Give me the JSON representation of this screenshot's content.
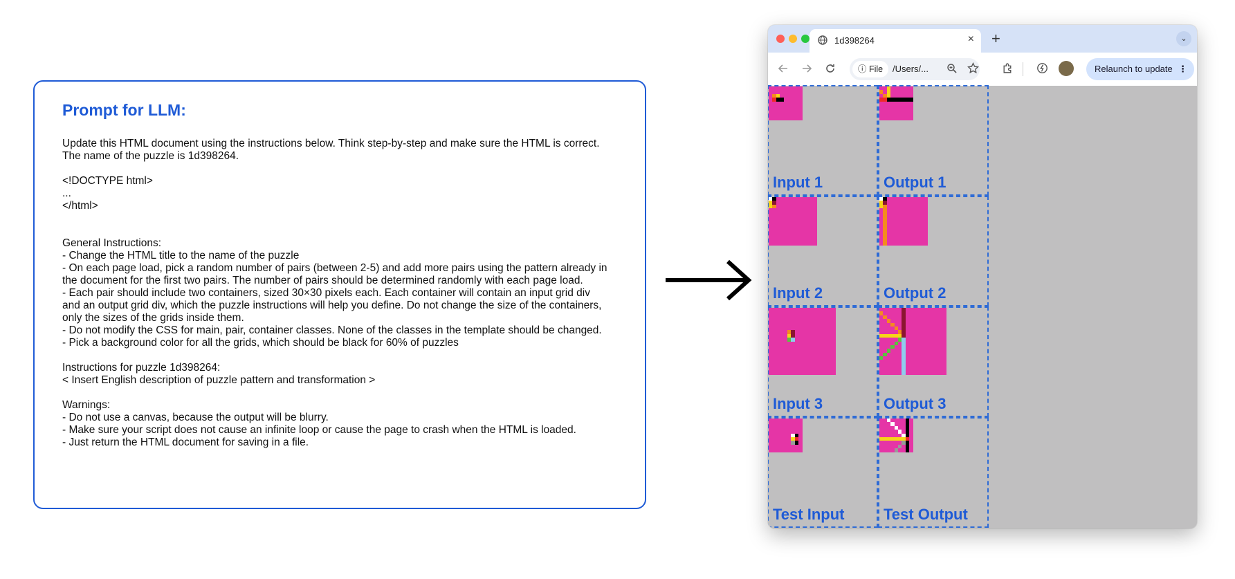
{
  "prompt": {
    "title": "Prompt for LLM:",
    "lines": [
      "Update this HTML document using the instructions below. Think step-by-step and make sure the HTML is correct.",
      "The name of the puzzle is 1d398264.",
      "",
      "<!DOCTYPE html>",
      "...",
      "</html>",
      "",
      "",
      "General Instructions:",
      "- Change the HTML title to the name of the puzzle",
      "- On each page load, pick a random number of pairs (between 2-5) and add more pairs using the pattern already in",
      "the document for the first two pairs. The number of pairs should be determined randomly with each page load.",
      "- Each pair should include two containers, sized 30×30 pixels each. Each container will contain an input grid div",
      "and an output grid div, which the puzzle instructions will help you define. Do not change the size of the containers,",
      "only the sizes of the grids inside them.",
      "- Do not modify the CSS for main, pair, container classes. None of the classes in the template should be changed.",
      "- Pick a background color for all the grids, which should be black for 60% of puzzles",
      "",
      "Instructions for puzzle 1d398264:",
      "< Insert English description of puzzle pattern and transformation >",
      "",
      "Warnings:",
      "- Do not use a canvas, because the output will be blurry.",
      "- Make sure your script does not cause an infinite loop or cause the page to crash when the HTML is loaded.",
      "- Just return the HTML document for saving in a file."
    ]
  },
  "browser": {
    "tab_title": "1d398264",
    "tab_close": "×",
    "new_tab": "+",
    "tab_menu": "⌄",
    "file_chip": "ⓘ File",
    "omnibox_path": "/Users/...",
    "relaunch_label": "Relaunch to update",
    "relaunch_dots": "⋮"
  },
  "colors": {
    "background": "#e535a6",
    "black": "#000000",
    "red": "#ee2a2a",
    "maroon": "#8b1530",
    "yellow": "#f7d518",
    "green": "#5cc23d",
    "lightblue": "#8fcdee",
    "orange": "#f58a1f",
    "grey": "#9a9a9a",
    "white": "#ffffff",
    "cell_border": "#2e6bd6",
    "label": "#1f5bd6"
  },
  "pairs": [
    {
      "input_label": "Input 1",
      "output_label": "Output 1",
      "input": {
        "size": 9,
        "seed": [
          [
            2,
            1,
            "orange",
            2,
            2,
            "yellow"
          ],
          [
            3,
            1,
            "red",
            3,
            2,
            "black"
          ],
          [
            3,
            3,
            "black"
          ]
        ]
      },
      "output": {
        "size": 9
      }
    },
    {
      "input_label": "Input 2",
      "output_label": "Output 2",
      "input": {
        "size": 13,
        "seed": [
          [
            0,
            0,
            "white",
            0,
            1,
            "black"
          ],
          [
            1,
            0,
            "yellow",
            1,
            1,
            "maroon"
          ],
          [
            2,
            0,
            "yellow",
            2,
            1,
            "orange"
          ]
        ]
      },
      "output": {
        "size": 13
      }
    },
    {
      "input_label": "Input 3",
      "output_label": "Output 3",
      "input": {
        "size": 18,
        "seed": [
          [
            6,
            5,
            "orange",
            6,
            6,
            "maroon"
          ],
          [
            7,
            5,
            "yellow",
            7,
            6,
            "maroon"
          ],
          [
            8,
            5,
            "green",
            8,
            6,
            "lightblue"
          ]
        ]
      },
      "output": {
        "size": 18
      }
    },
    {
      "input_label": "Test Input",
      "output_label": "Test Output",
      "input": {
        "size": 9,
        "seed": [
          [
            4,
            6,
            "white",
            4,
            7,
            "black"
          ],
          [
            5,
            6,
            "yellow",
            5,
            7,
            "red"
          ],
          [
            6,
            6,
            "grey",
            6,
            7,
            "black"
          ]
        ]
      },
      "output": {
        "size": 9
      }
    }
  ]
}
